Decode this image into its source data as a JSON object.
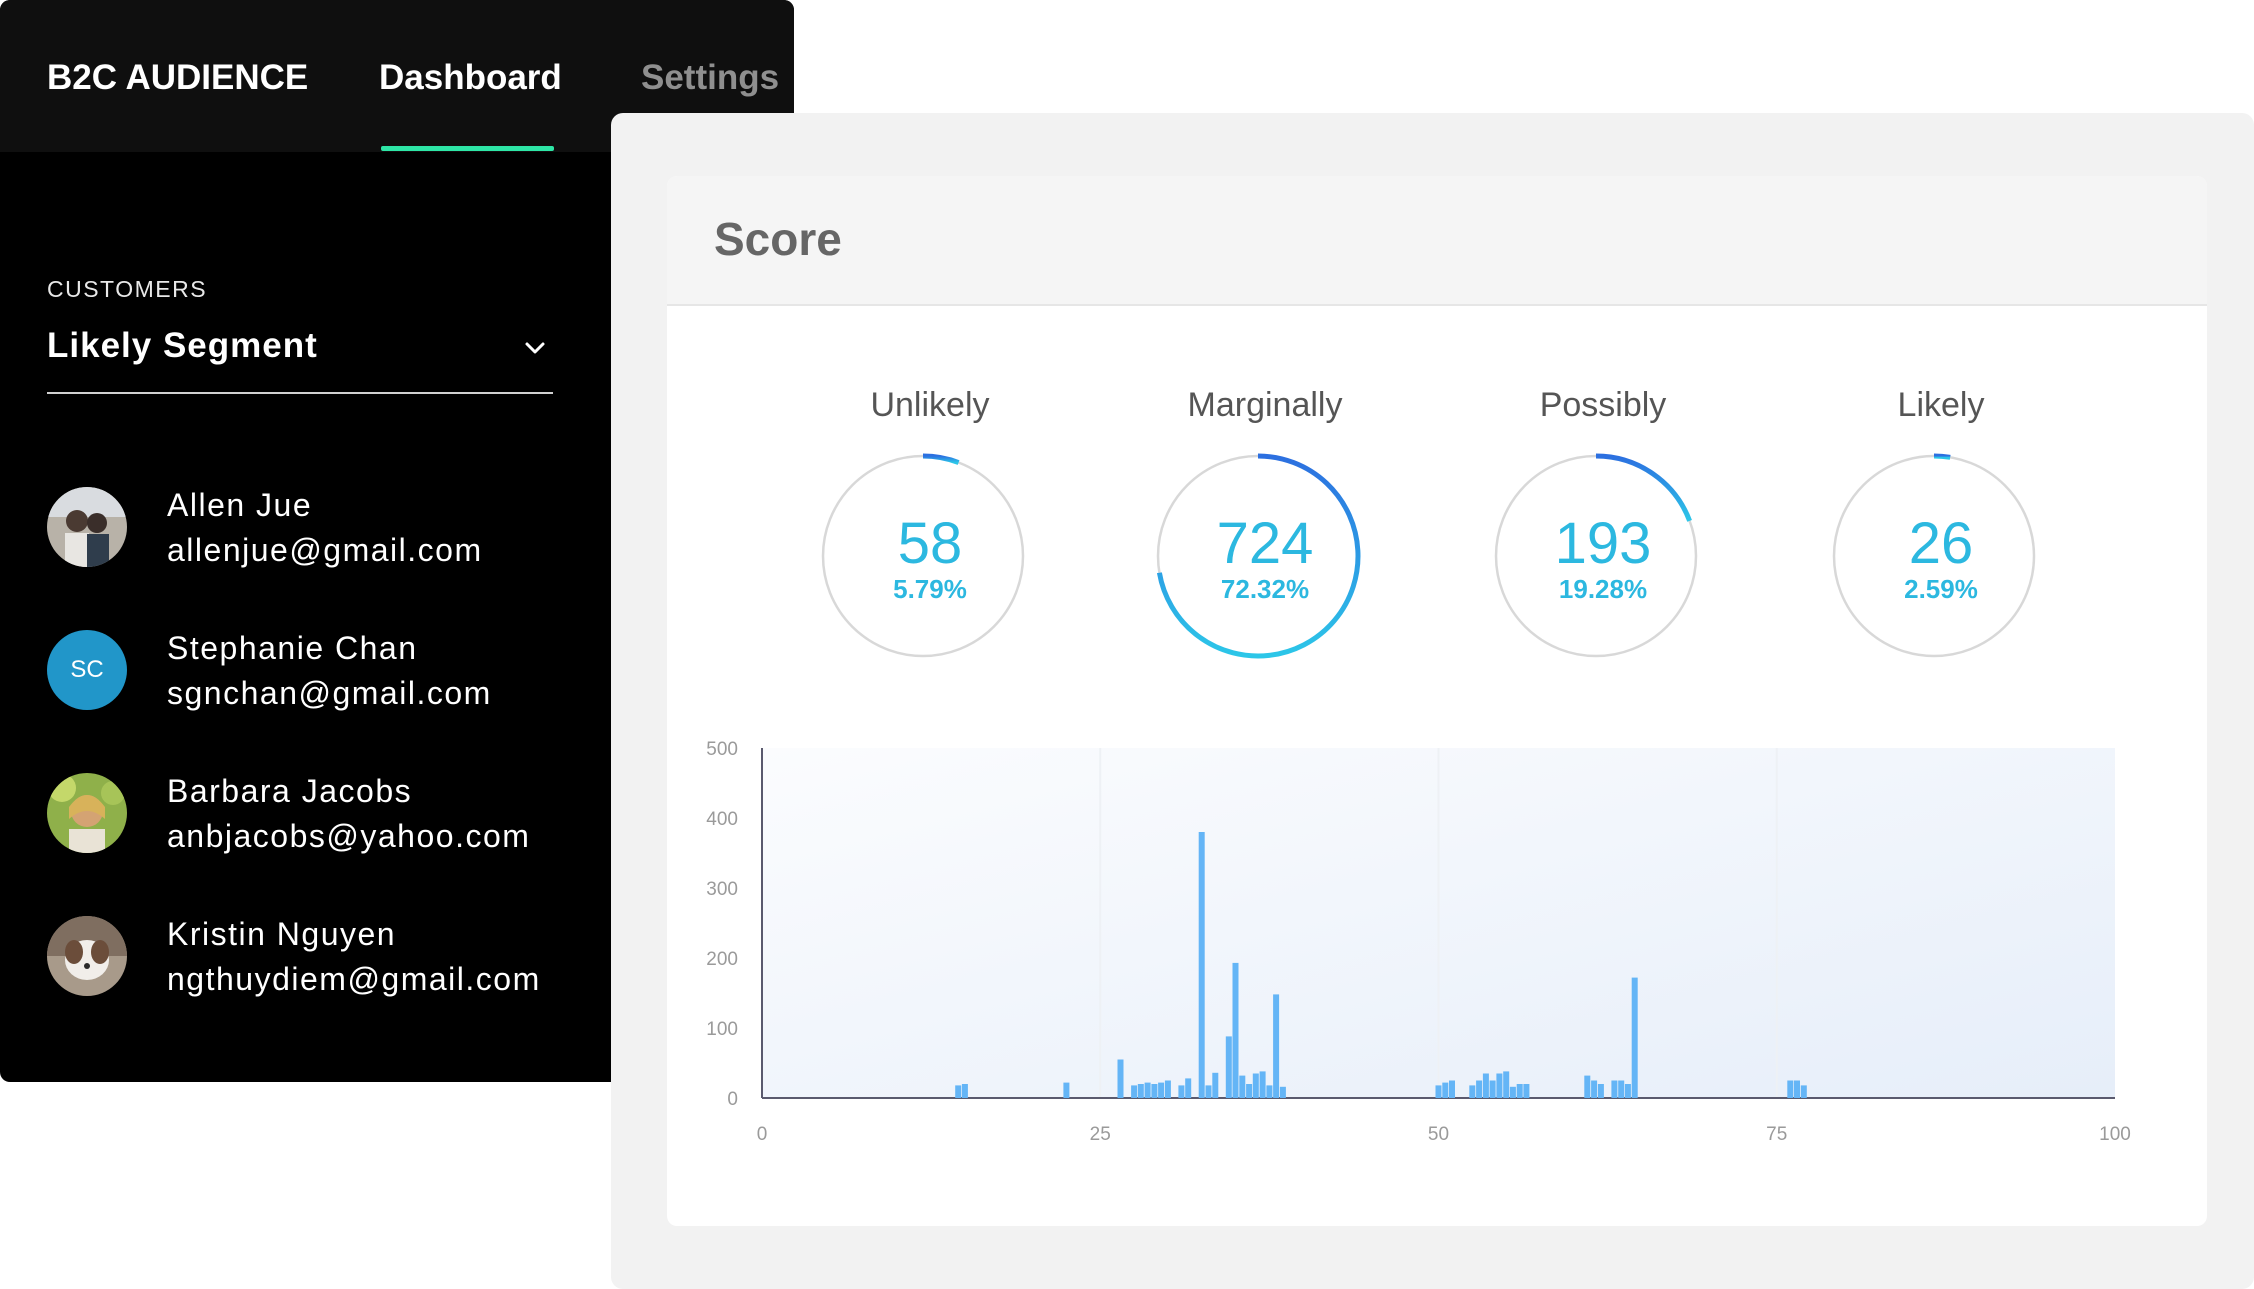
{
  "header": {
    "brand": "B2C AUDIENCE",
    "tabs": [
      {
        "label": "Dashboard",
        "active": true
      },
      {
        "label": "Settings",
        "active": false
      }
    ],
    "accent_color": "#2ee6a6"
  },
  "segment": {
    "label": "CUSTOMERS",
    "selected": "Likely Segment",
    "icon": "chevron-down-icon"
  },
  "customers": [
    {
      "name": "Allen Jue",
      "email": "allenjue@gmail.com",
      "avatar": "photo"
    },
    {
      "name": "Stephanie Chan",
      "email": "sgnchan@gmail.com",
      "avatar": "initials",
      "initials": "SC"
    },
    {
      "name": "Barbara Jacobs",
      "email": "anbjacobs@yahoo.com",
      "avatar": "photo"
    },
    {
      "name": "Kristin Nguyen",
      "email": "ngthuydiem@gmail.com",
      "avatar": "photo"
    }
  ],
  "score": {
    "title": "Score",
    "stats": [
      {
        "label": "Unlikely",
        "count": "58",
        "percent": "5.79%",
        "fraction": 0.0579
      },
      {
        "label": "Marginally",
        "count": "724",
        "percent": "72.32%",
        "fraction": 0.7232
      },
      {
        "label": "Possibly",
        "count": "193",
        "percent": "19.28%",
        "fraction": 0.1928
      },
      {
        "label": "Likely",
        "count": "26",
        "percent": "2.59%",
        "fraction": 0.0259
      }
    ],
    "colors": {
      "value": "#2cb8e0",
      "ring": "#d8d8d8",
      "bar": "#64b5f6"
    }
  },
  "chart_data": {
    "type": "bar",
    "title": "",
    "xlabel": "",
    "ylabel": "",
    "xlim": [
      0,
      100
    ],
    "ylim": [
      0,
      500
    ],
    "x_ticks": [
      "0",
      "25",
      "50",
      "75",
      "100"
    ],
    "y_ticks": [
      "500",
      "400",
      "300",
      "200",
      "100",
      "0"
    ],
    "grid": false,
    "bar_color": "#64b5f6",
    "x": [
      14.5,
      15.0,
      22.5,
      26.5,
      27.5,
      28.0,
      28.5,
      29.0,
      29.5,
      30.0,
      31.0,
      31.5,
      32.5,
      33.0,
      33.5,
      34.5,
      35.0,
      35.5,
      36.0,
      36.5,
      37.0,
      37.5,
      38.0,
      38.5,
      50.0,
      50.5,
      51.0,
      52.5,
      53.0,
      53.5,
      54.0,
      54.5,
      55.0,
      55.5,
      56.0,
      56.5,
      61.0,
      61.5,
      62.0,
      63.0,
      63.5,
      64.0,
      64.5,
      76.0,
      76.5,
      77.0
    ],
    "values": [
      18,
      20,
      22,
      55,
      18,
      20,
      22,
      20,
      22,
      25,
      18,
      28,
      380,
      18,
      36,
      88,
      193,
      32,
      20,
      35,
      38,
      18,
      148,
      16,
      18,
      22,
      25,
      18,
      25,
      35,
      25,
      35,
      38,
      16,
      20,
      20,
      32,
      25,
      20,
      25,
      25,
      20,
      172,
      25,
      25,
      18
    ]
  }
}
